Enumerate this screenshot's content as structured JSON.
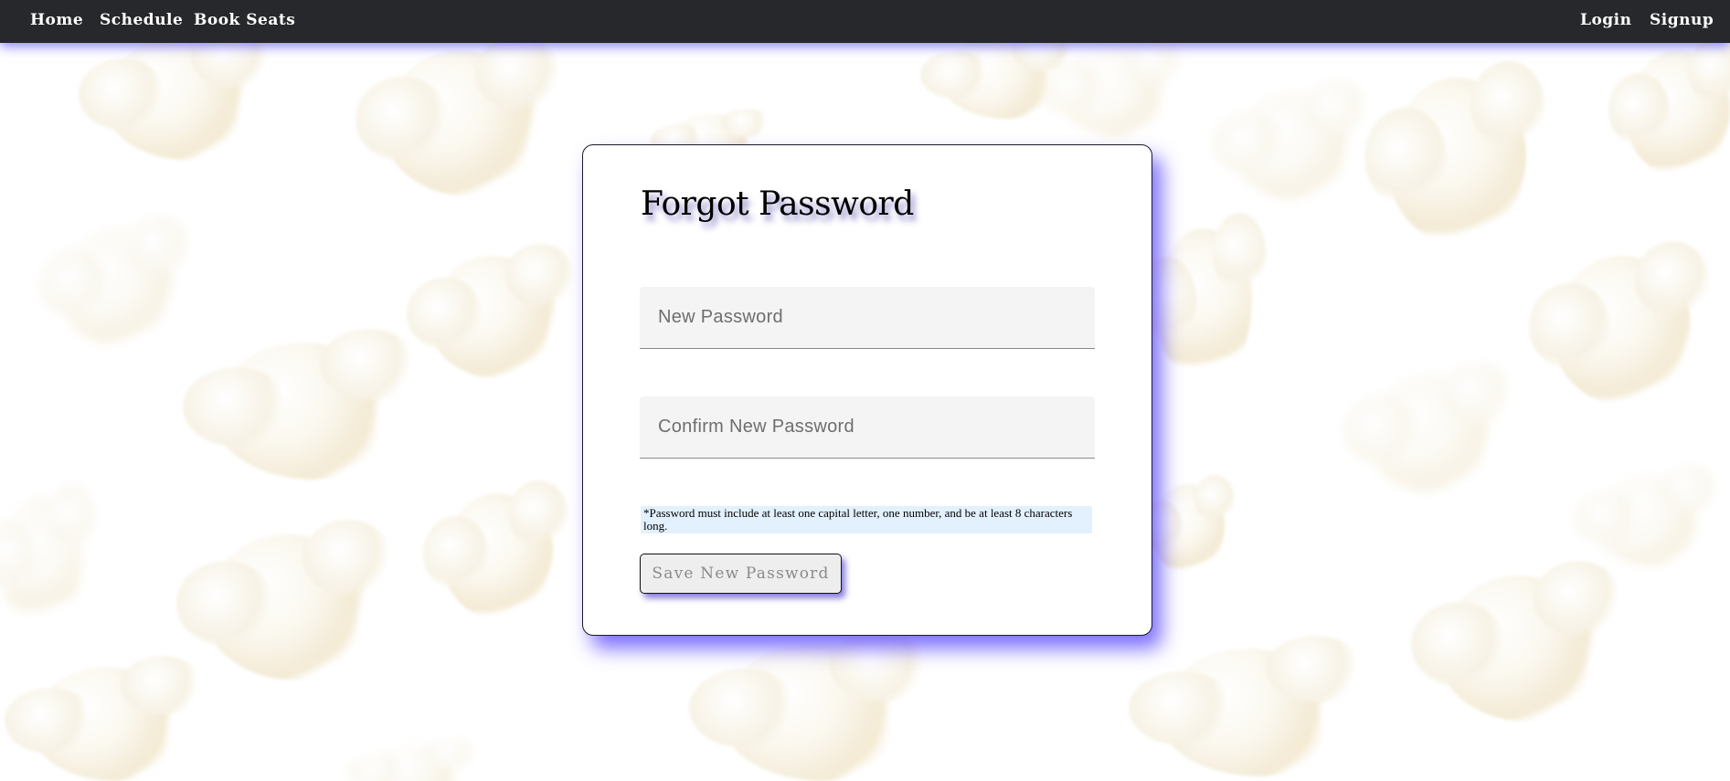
{
  "nav": {
    "home": "Home",
    "schedule": "Schedule",
    "book_seats": "Book Seats",
    "login": "Login",
    "signup": "Signup"
  },
  "form": {
    "title": "Forgot Password",
    "new_password_placeholder": "New Password",
    "new_password_value": "",
    "confirm_password_placeholder": "Confirm New Password",
    "confirm_password_value": "",
    "hint": "*Password must include at least one capital letter, one number, and be at least 8 characters long.",
    "save_label": "Save New Password"
  },
  "colors": {
    "navbar": "#27282c",
    "accent_glow": "#5046ff",
    "hint_bg": "#e3f1ff",
    "field_bg": "#f4f4f4"
  }
}
